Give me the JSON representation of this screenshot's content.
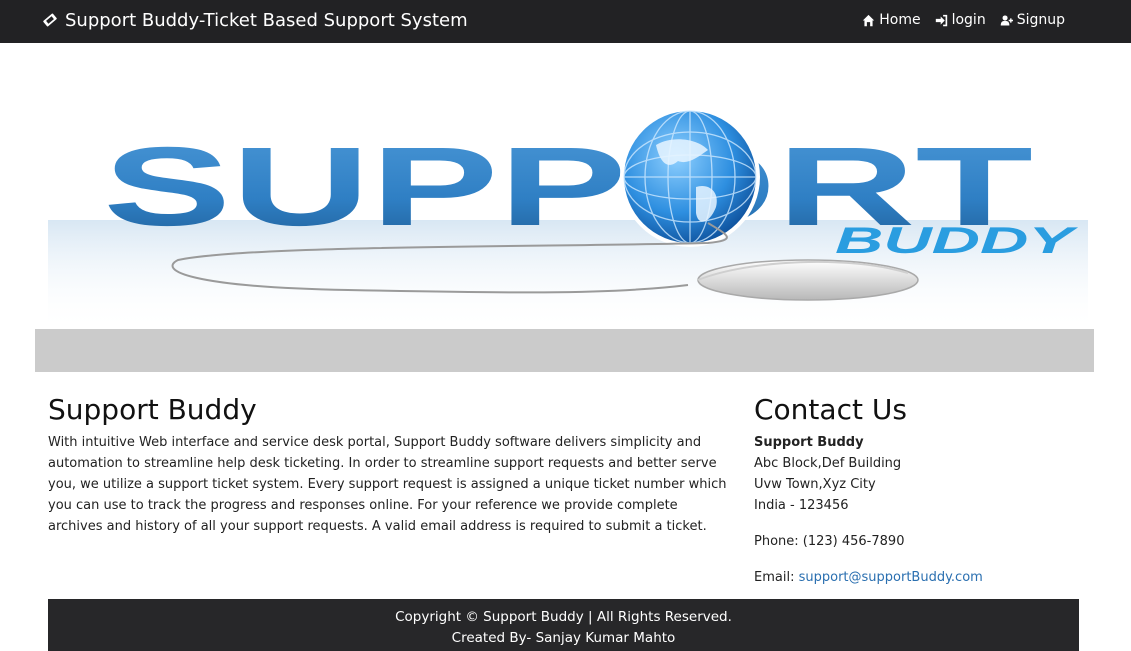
{
  "navbar": {
    "brand": "Support Buddy-Ticket Based Support System",
    "brand_icon": "ticket-icon",
    "links": [
      {
        "label": "Home",
        "icon": "home-icon"
      },
      {
        "label": "login",
        "icon": "sign-in-icon"
      },
      {
        "label": "Signup",
        "icon": "user-plus-icon"
      }
    ]
  },
  "banner": {
    "logo_main": "SUPPORT",
    "logo_sub": "BUDDY",
    "colors": {
      "primary": "#2f7fc4",
      "sub": "#2a9de0"
    }
  },
  "about": {
    "title": "Support Buddy",
    "text": "With intuitive Web interface and service desk portal, Support Buddy software delivers simplicity and automation to streamline help desk ticketing. In order to streamline support requests and better serve you, we utilize a support ticket system. Every support request is assigned a unique ticket number which you can use to track the progress and responses online. For your reference we provide complete archives and history of all your support requests. A valid email address is required to submit a ticket."
  },
  "contact": {
    "title": "Contact Us",
    "company": "Support Buddy",
    "address1": "Abc Block,Def Building",
    "address2": "Uvw Town,Xyz City",
    "address3": "India - 123456",
    "phone": "Phone: (123) 456-7890",
    "email_label": "Email:",
    "email": "support@supportBuddy.com"
  },
  "footer": {
    "copyright": "Copyright © Support Buddy | All Rights Reserved.",
    "credit": "Created By- Sanjay Kumar Mahto"
  }
}
